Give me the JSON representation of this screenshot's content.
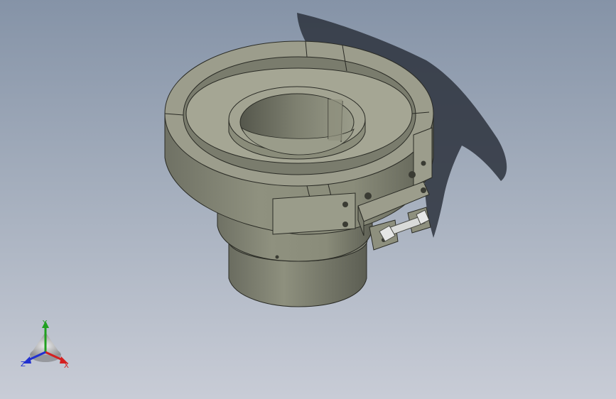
{
  "viewport": {
    "background_top": "#8593a7",
    "background_bottom": "#c8ccd6"
  },
  "part": {
    "body_color": "#888a78",
    "top_face_color": "#9c9d8c",
    "inner_color": "#6c6e60",
    "shadow_color": "#2d333d",
    "pin_color": "#d9dbd9"
  },
  "triad": {
    "x_label": "X",
    "y_label": "Y",
    "z_label": "Z",
    "x_color": "#d42020",
    "y_color": "#20a020",
    "z_color": "#2030d0"
  }
}
